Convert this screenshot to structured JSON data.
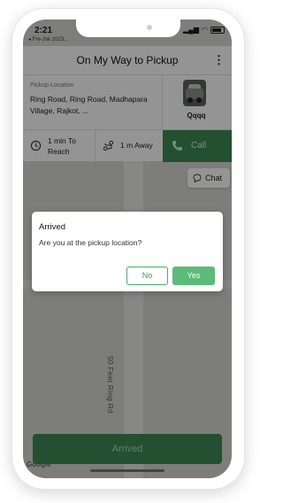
{
  "status_bar": {
    "time": "2:21",
    "sub_text": "◂ Fre-Jnk 2023..."
  },
  "app_bar": {
    "title": "On My Way to Pickup"
  },
  "pickup": {
    "label": "Pickup Location",
    "address": "Ring Road, Ring Road, Madhapara Village, Rajkot, ..."
  },
  "driver": {
    "name": "Qqqq"
  },
  "stats": {
    "eta": "1 min To Reach",
    "distance": "1 m Away"
  },
  "actions": {
    "call_label": "Call",
    "chat_label": "Chat",
    "arrived_label": "Arrived"
  },
  "map": {
    "road_name": "50 Feet Ring Rd",
    "provider": "Google"
  },
  "dialog": {
    "title": "Arrived",
    "message": "Are you at the pickup location?",
    "no_label": "No",
    "yes_label": "Yes"
  },
  "colors": {
    "primary_green": "#3c8a55",
    "dialog_yes": "#5cbb78"
  }
}
